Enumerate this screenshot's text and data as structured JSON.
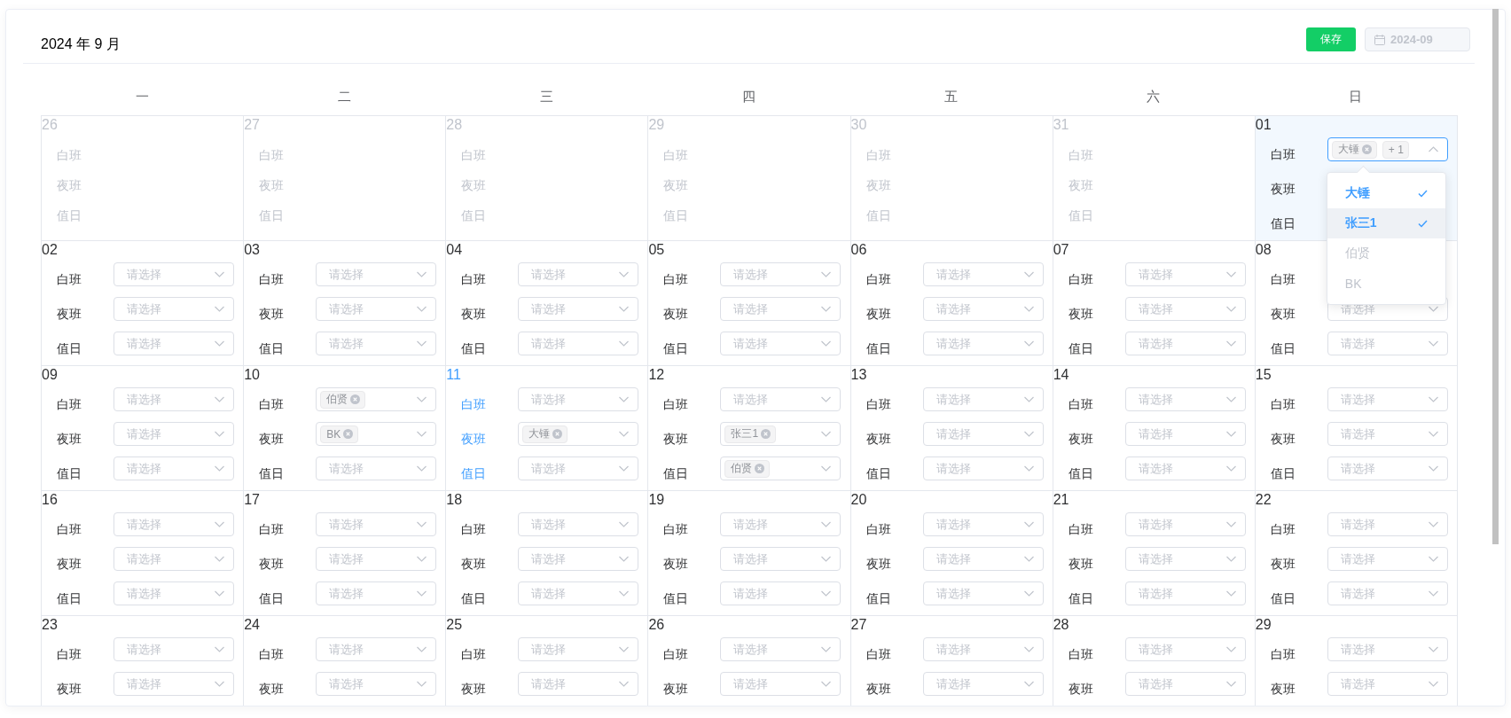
{
  "title": "2024 年 9 月",
  "save_button": "保存",
  "month_picker": {
    "value": "2024-09",
    "disabled": true
  },
  "weekdays": [
    "一",
    "二",
    "三",
    "四",
    "五",
    "六",
    "日"
  ],
  "weeks": [
    [
      {
        "date": "26",
        "kind": "outside",
        "selected": false,
        "today": false,
        "shifts": [
          {
            "label": "白班"
          },
          {
            "label": "夜班"
          },
          {
            "label": "值日"
          }
        ]
      },
      {
        "date": "27",
        "kind": "outside",
        "selected": false,
        "today": false,
        "shifts": [
          {
            "label": "白班"
          },
          {
            "label": "夜班"
          },
          {
            "label": "值日"
          }
        ]
      },
      {
        "date": "28",
        "kind": "outside",
        "selected": false,
        "today": false,
        "shifts": [
          {
            "label": "白班"
          },
          {
            "label": "夜班"
          },
          {
            "label": "值日"
          }
        ]
      },
      {
        "date": "29",
        "kind": "outside",
        "selected": false,
        "today": false,
        "shifts": [
          {
            "label": "白班"
          },
          {
            "label": "夜班"
          },
          {
            "label": "值日"
          }
        ]
      },
      {
        "date": "30",
        "kind": "outside",
        "selected": false,
        "today": false,
        "shifts": [
          {
            "label": "白班"
          },
          {
            "label": "夜班"
          },
          {
            "label": "值日"
          }
        ]
      },
      {
        "date": "31",
        "kind": "outside",
        "selected": false,
        "today": false,
        "shifts": [
          {
            "label": "白班"
          },
          {
            "label": "夜班"
          },
          {
            "label": "值日"
          }
        ]
      },
      {
        "date": "01",
        "kind": "current",
        "selected": true,
        "today": false,
        "shifts": [
          {
            "label": "白班",
            "select": {
              "focused": true,
              "tags": [
                "大锤"
              ],
              "more": "+ 1"
            }
          },
          {
            "label": "夜班"
          },
          {
            "label": "值日"
          }
        ],
        "dropdown": {
          "options": [
            {
              "label": "大锤",
              "selected": true,
              "hovered": false,
              "disabled": false
            },
            {
              "label": "张三1",
              "selected": true,
              "hovered": true,
              "disabled": false
            },
            {
              "label": "伯贤",
              "selected": false,
              "hovered": false,
              "disabled": true
            },
            {
              "label": "BK",
              "selected": false,
              "hovered": false,
              "disabled": true
            }
          ]
        }
      }
    ],
    [
      {
        "date": "02",
        "kind": "current",
        "selected": false,
        "today": false,
        "shifts": [
          {
            "label": "白班",
            "select": {
              "focused": false,
              "placeholder": "请选择"
            }
          },
          {
            "label": "夜班",
            "select": {
              "focused": false,
              "placeholder": "请选择"
            }
          },
          {
            "label": "值日",
            "select": {
              "focused": false,
              "placeholder": "请选择"
            }
          }
        ]
      },
      {
        "date": "03",
        "kind": "current",
        "selected": false,
        "today": false,
        "shifts": [
          {
            "label": "白班",
            "select": {
              "focused": false,
              "placeholder": "请选择"
            }
          },
          {
            "label": "夜班",
            "select": {
              "focused": false,
              "placeholder": "请选择"
            }
          },
          {
            "label": "值日",
            "select": {
              "focused": false,
              "placeholder": "请选择"
            }
          }
        ]
      },
      {
        "date": "04",
        "kind": "current",
        "selected": false,
        "today": false,
        "shifts": [
          {
            "label": "白班",
            "select": {
              "focused": false,
              "placeholder": "请选择"
            }
          },
          {
            "label": "夜班",
            "select": {
              "focused": false,
              "placeholder": "请选择"
            }
          },
          {
            "label": "值日",
            "select": {
              "focused": false,
              "placeholder": "请选择"
            }
          }
        ]
      },
      {
        "date": "05",
        "kind": "current",
        "selected": false,
        "today": false,
        "shifts": [
          {
            "label": "白班",
            "select": {
              "focused": false,
              "placeholder": "请选择"
            }
          },
          {
            "label": "夜班",
            "select": {
              "focused": false,
              "placeholder": "请选择"
            }
          },
          {
            "label": "值日",
            "select": {
              "focused": false,
              "placeholder": "请选择"
            }
          }
        ]
      },
      {
        "date": "06",
        "kind": "current",
        "selected": false,
        "today": false,
        "shifts": [
          {
            "label": "白班",
            "select": {
              "focused": false,
              "placeholder": "请选择"
            }
          },
          {
            "label": "夜班",
            "select": {
              "focused": false,
              "placeholder": "请选择"
            }
          },
          {
            "label": "值日",
            "select": {
              "focused": false,
              "placeholder": "请选择"
            }
          }
        ]
      },
      {
        "date": "07",
        "kind": "current",
        "selected": false,
        "today": false,
        "shifts": [
          {
            "label": "白班",
            "select": {
              "focused": false,
              "placeholder": "请选择"
            }
          },
          {
            "label": "夜班",
            "select": {
              "focused": false,
              "placeholder": "请选择"
            }
          },
          {
            "label": "值日",
            "select": {
              "focused": false,
              "placeholder": "请选择"
            }
          }
        ]
      },
      {
        "date": "08",
        "kind": "current",
        "selected": false,
        "today": false,
        "shifts": [
          {
            "label": "白班"
          },
          {
            "label": "夜班",
            "select": {
              "focused": false,
              "placeholder": "请选择"
            }
          },
          {
            "label": "值日",
            "select": {
              "focused": false,
              "placeholder": "请选择"
            }
          }
        ]
      }
    ],
    [
      {
        "date": "09",
        "kind": "current",
        "selected": false,
        "today": false,
        "shifts": [
          {
            "label": "白班",
            "select": {
              "focused": false,
              "placeholder": "请选择"
            }
          },
          {
            "label": "夜班",
            "select": {
              "focused": false,
              "placeholder": "请选择"
            }
          },
          {
            "label": "值日",
            "select": {
              "focused": false,
              "placeholder": "请选择"
            }
          }
        ]
      },
      {
        "date": "10",
        "kind": "current",
        "selected": false,
        "today": false,
        "shifts": [
          {
            "label": "白班",
            "select": {
              "focused": false,
              "tags": [
                "伯贤"
              ]
            }
          },
          {
            "label": "夜班",
            "select": {
              "focused": false,
              "tags": [
                "BK"
              ]
            }
          },
          {
            "label": "值日",
            "select": {
              "focused": false,
              "placeholder": "请选择"
            }
          }
        ]
      },
      {
        "date": "11",
        "kind": "current",
        "selected": false,
        "today": true,
        "shifts": [
          {
            "label": "白班",
            "select": {
              "focused": false,
              "placeholder": "请选择"
            }
          },
          {
            "label": "夜班",
            "select": {
              "focused": false,
              "tags": [
                "大锤"
              ]
            }
          },
          {
            "label": "值日",
            "select": {
              "focused": false,
              "placeholder": "请选择"
            }
          }
        ]
      },
      {
        "date": "12",
        "kind": "current",
        "selected": false,
        "today": false,
        "shifts": [
          {
            "label": "白班",
            "select": {
              "focused": false,
              "placeholder": "请选择"
            }
          },
          {
            "label": "夜班",
            "select": {
              "focused": false,
              "tags": [
                "张三1"
              ]
            }
          },
          {
            "label": "值日",
            "select": {
              "focused": false,
              "tags": [
                "伯贤"
              ]
            }
          }
        ]
      },
      {
        "date": "13",
        "kind": "current",
        "selected": false,
        "today": false,
        "shifts": [
          {
            "label": "白班",
            "select": {
              "focused": false,
              "placeholder": "请选择"
            }
          },
          {
            "label": "夜班",
            "select": {
              "focused": false,
              "placeholder": "请选择"
            }
          },
          {
            "label": "值日",
            "select": {
              "focused": false,
              "placeholder": "请选择"
            }
          }
        ]
      },
      {
        "date": "14",
        "kind": "current",
        "selected": false,
        "today": false,
        "shifts": [
          {
            "label": "白班",
            "select": {
              "focused": false,
              "placeholder": "请选择"
            }
          },
          {
            "label": "夜班",
            "select": {
              "focused": false,
              "placeholder": "请选择"
            }
          },
          {
            "label": "值日",
            "select": {
              "focused": false,
              "placeholder": "请选择"
            }
          }
        ]
      },
      {
        "date": "15",
        "kind": "current",
        "selected": false,
        "today": false,
        "shifts": [
          {
            "label": "白班",
            "select": {
              "focused": false,
              "placeholder": "请选择"
            }
          },
          {
            "label": "夜班",
            "select": {
              "focused": false,
              "placeholder": "请选择"
            }
          },
          {
            "label": "值日",
            "select": {
              "focused": false,
              "placeholder": "请选择"
            }
          }
        ]
      }
    ],
    [
      {
        "date": "16",
        "kind": "current",
        "selected": false,
        "today": false,
        "shifts": [
          {
            "label": "白班",
            "select": {
              "focused": false,
              "placeholder": "请选择"
            }
          },
          {
            "label": "夜班",
            "select": {
              "focused": false,
              "placeholder": "请选择"
            }
          },
          {
            "label": "值日",
            "select": {
              "focused": false,
              "placeholder": "请选择"
            }
          }
        ]
      },
      {
        "date": "17",
        "kind": "current",
        "selected": false,
        "today": false,
        "shifts": [
          {
            "label": "白班",
            "select": {
              "focused": false,
              "placeholder": "请选择"
            }
          },
          {
            "label": "夜班",
            "select": {
              "focused": false,
              "placeholder": "请选择"
            }
          },
          {
            "label": "值日",
            "select": {
              "focused": false,
              "placeholder": "请选择"
            }
          }
        ]
      },
      {
        "date": "18",
        "kind": "current",
        "selected": false,
        "today": false,
        "shifts": [
          {
            "label": "白班",
            "select": {
              "focused": false,
              "placeholder": "请选择"
            }
          },
          {
            "label": "夜班",
            "select": {
              "focused": false,
              "placeholder": "请选择"
            }
          },
          {
            "label": "值日",
            "select": {
              "focused": false,
              "placeholder": "请选择"
            }
          }
        ]
      },
      {
        "date": "19",
        "kind": "current",
        "selected": false,
        "today": false,
        "shifts": [
          {
            "label": "白班",
            "select": {
              "focused": false,
              "placeholder": "请选择"
            }
          },
          {
            "label": "夜班",
            "select": {
              "focused": false,
              "placeholder": "请选择"
            }
          },
          {
            "label": "值日",
            "select": {
              "focused": false,
              "placeholder": "请选择"
            }
          }
        ]
      },
      {
        "date": "20",
        "kind": "current",
        "selected": false,
        "today": false,
        "shifts": [
          {
            "label": "白班",
            "select": {
              "focused": false,
              "placeholder": "请选择"
            }
          },
          {
            "label": "夜班",
            "select": {
              "focused": false,
              "placeholder": "请选择"
            }
          },
          {
            "label": "值日",
            "select": {
              "focused": false,
              "placeholder": "请选择"
            }
          }
        ]
      },
      {
        "date": "21",
        "kind": "current",
        "selected": false,
        "today": false,
        "shifts": [
          {
            "label": "白班",
            "select": {
              "focused": false,
              "placeholder": "请选择"
            }
          },
          {
            "label": "夜班",
            "select": {
              "focused": false,
              "placeholder": "请选择"
            }
          },
          {
            "label": "值日",
            "select": {
              "focused": false,
              "placeholder": "请选择"
            }
          }
        ]
      },
      {
        "date": "22",
        "kind": "current",
        "selected": false,
        "today": false,
        "shifts": [
          {
            "label": "白班",
            "select": {
              "focused": false,
              "placeholder": "请选择"
            }
          },
          {
            "label": "夜班",
            "select": {
              "focused": false,
              "placeholder": "请选择"
            }
          },
          {
            "label": "值日",
            "select": {
              "focused": false,
              "placeholder": "请选择"
            }
          }
        ]
      }
    ],
    [
      {
        "date": "23",
        "kind": "current",
        "selected": false,
        "today": false,
        "shifts": [
          {
            "label": "白班",
            "select": {
              "focused": false,
              "placeholder": "请选择"
            }
          },
          {
            "label": "夜班",
            "select": {
              "focused": false,
              "placeholder": "请选择"
            }
          }
        ]
      },
      {
        "date": "24",
        "kind": "current",
        "selected": false,
        "today": false,
        "shifts": [
          {
            "label": "白班",
            "select": {
              "focused": false,
              "placeholder": "请选择"
            }
          },
          {
            "label": "夜班",
            "select": {
              "focused": false,
              "placeholder": "请选择"
            }
          }
        ]
      },
      {
        "date": "25",
        "kind": "current",
        "selected": false,
        "today": false,
        "shifts": [
          {
            "label": "白班",
            "select": {
              "focused": false,
              "placeholder": "请选择"
            }
          },
          {
            "label": "夜班",
            "select": {
              "focused": false,
              "placeholder": "请选择"
            }
          }
        ]
      },
      {
        "date": "26",
        "kind": "current",
        "selected": false,
        "today": false,
        "shifts": [
          {
            "label": "白班",
            "select": {
              "focused": false,
              "placeholder": "请选择"
            }
          },
          {
            "label": "夜班",
            "select": {
              "focused": false,
              "placeholder": "请选择"
            }
          }
        ]
      },
      {
        "date": "27",
        "kind": "current",
        "selected": false,
        "today": false,
        "shifts": [
          {
            "label": "白班",
            "select": {
              "focused": false,
              "placeholder": "请选择"
            }
          },
          {
            "label": "夜班",
            "select": {
              "focused": false,
              "placeholder": "请选择"
            }
          }
        ]
      },
      {
        "date": "28",
        "kind": "current",
        "selected": false,
        "today": false,
        "shifts": [
          {
            "label": "白班",
            "select": {
              "focused": false,
              "placeholder": "请选择"
            }
          },
          {
            "label": "夜班",
            "select": {
              "focused": false,
              "placeholder": "请选择"
            }
          }
        ]
      },
      {
        "date": "29",
        "kind": "current",
        "selected": false,
        "today": false,
        "shifts": [
          {
            "label": "白班",
            "select": {
              "focused": false,
              "placeholder": "请选择"
            }
          },
          {
            "label": "夜班",
            "select": {
              "focused": false,
              "placeholder": "请选择"
            }
          }
        ]
      }
    ]
  ]
}
